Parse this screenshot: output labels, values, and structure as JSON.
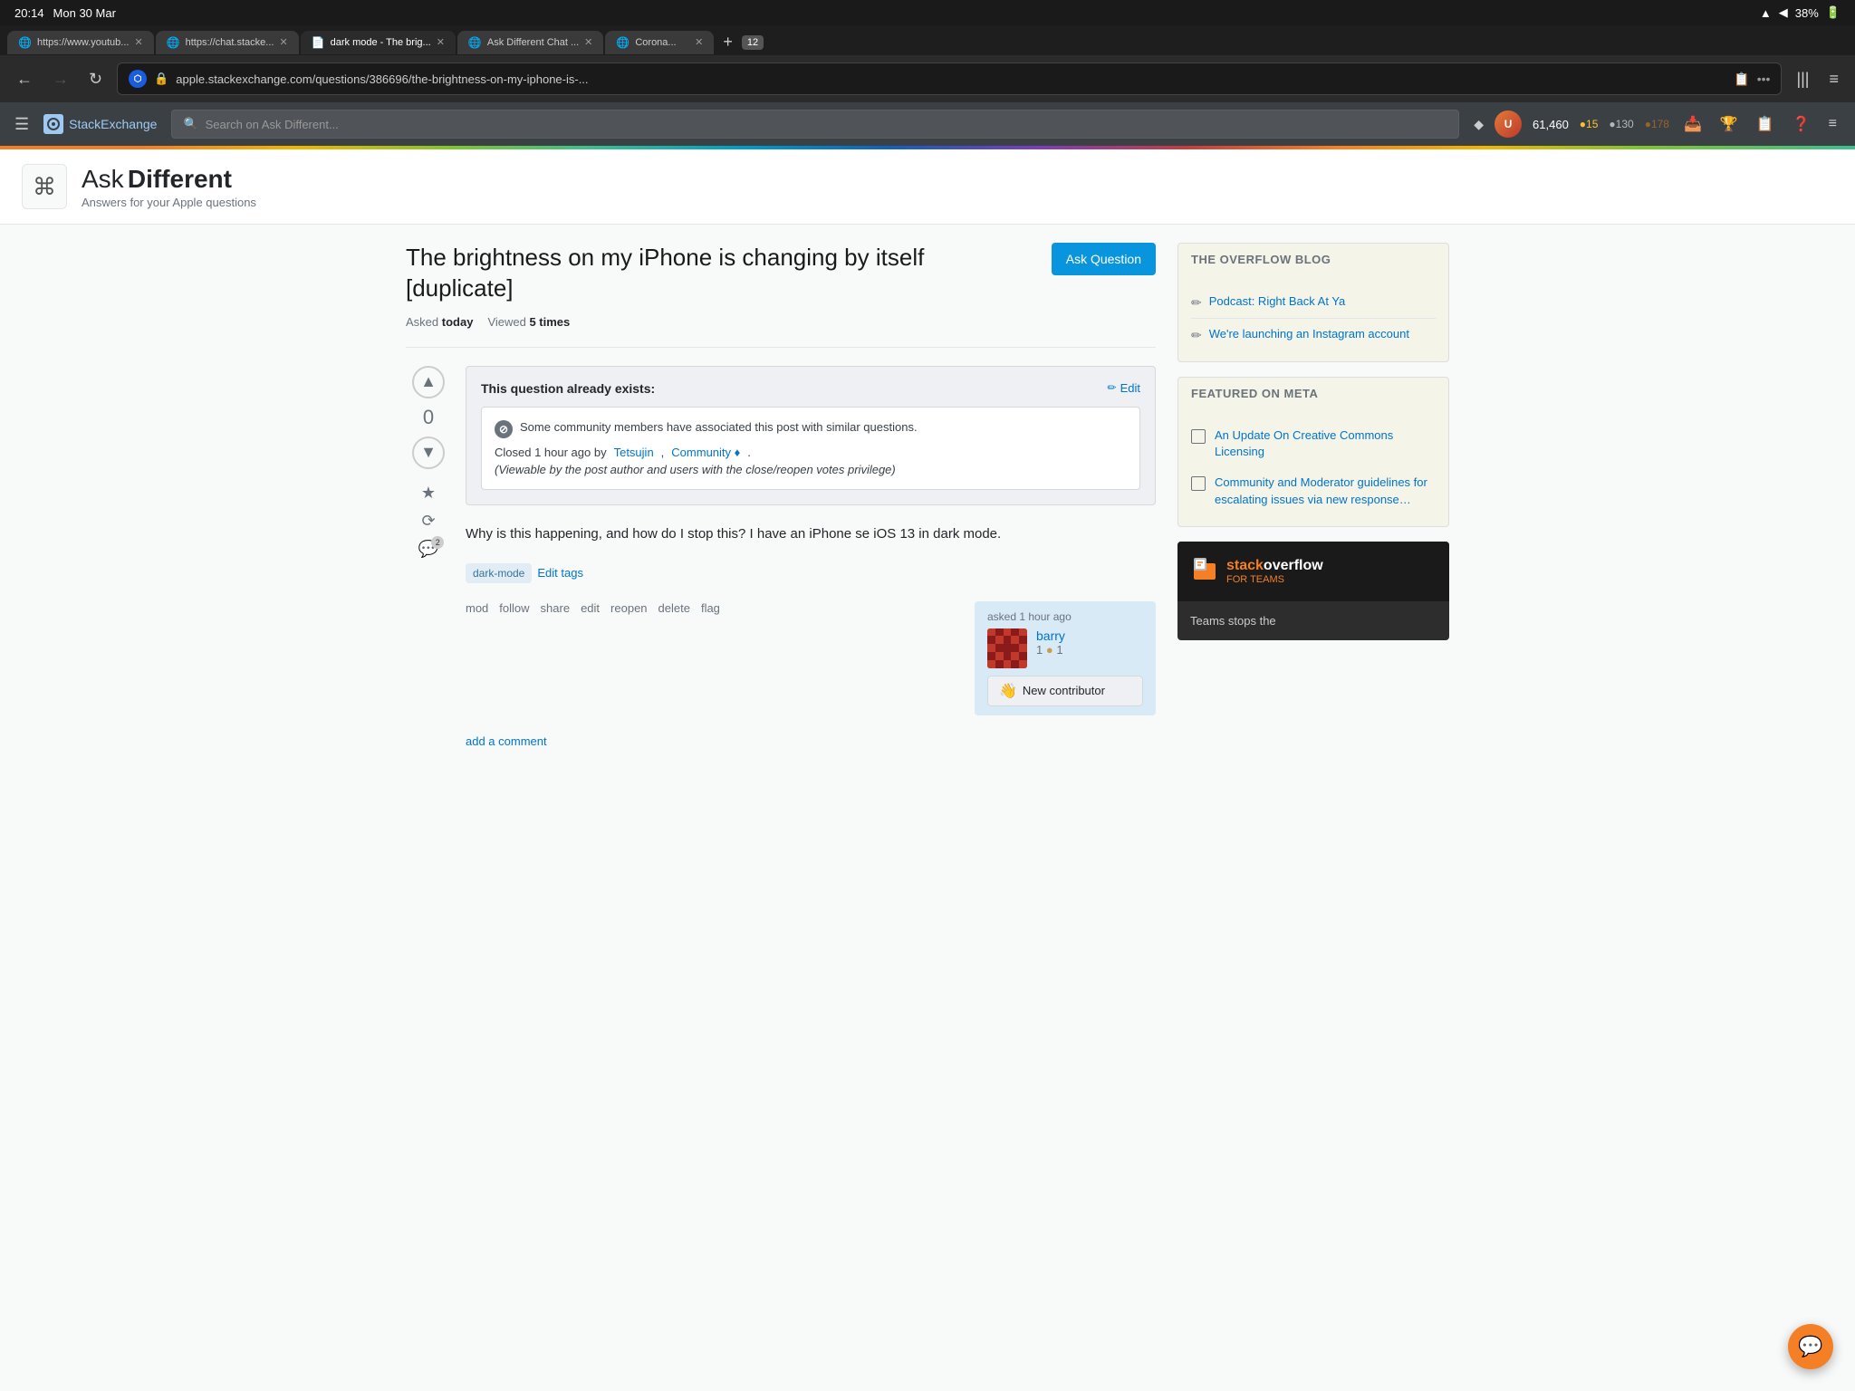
{
  "statusBar": {
    "time": "20:14",
    "date": "Mon 30 Mar",
    "wifi": "WiFi",
    "signal": "Signal",
    "battery": "38%"
  },
  "browser": {
    "tabs": [
      {
        "id": "tab1",
        "icon": "🌐",
        "label": "https://www.youtub...",
        "active": false
      },
      {
        "id": "tab2",
        "icon": "🌐",
        "label": "https://chat.stacke...",
        "active": false
      },
      {
        "id": "tab3",
        "icon": "📄",
        "label": "dark mode - The brig...",
        "active": true
      },
      {
        "id": "tab4",
        "icon": "🌐",
        "label": "Ask Different Chat ...",
        "active": false
      },
      {
        "id": "tab5",
        "icon": "🌐",
        "label": "Corona...",
        "active": false
      }
    ],
    "extraTabCount": "12",
    "addressBar": {
      "url": "apple.stackexchange.com/questions/386696/the-brightness-on-my-iphone-is-..."
    }
  },
  "seHeader": {
    "logoText": "StackExchange",
    "searchPlaceholder": "Search on Ask Different...",
    "reputation": "61,460",
    "repGold": "15",
    "repSilver": "130",
    "repBronze": "178"
  },
  "siteName": {
    "ask": "Ask",
    "different": "Different",
    "tagline": "Answers for your Apple questions"
  },
  "question": {
    "title": "The brightness on my iPhone is changing by itself [duplicate]",
    "askButtonLabel": "Ask Question",
    "askedLabel": "Asked",
    "askedValue": "today",
    "viewedLabel": "Viewed",
    "viewedValue": "5 times",
    "voteCount": "0",
    "duplicateNotice": {
      "title": "This question already exists:",
      "editLabel": "Edit",
      "innerText": "Some community members have associated this post with similar questions.",
      "closedBy": "Closed 1 hour ago by",
      "closedByUsers": [
        "Tetsujin",
        "Community ♦"
      ],
      "viewableNote": "(Viewable by the post author and users with the close/reopen votes privilege)"
    },
    "bodyText": "Why is this happening, and how do I stop this? I have an iPhone se iOS 13 in dark mode.",
    "tags": [
      "dark-mode"
    ],
    "editTagsLabel": "Edit tags",
    "actions": {
      "mod": "mod",
      "follow": "follow",
      "share": "share",
      "edit": "edit",
      "reopen": "reopen",
      "delete": "delete",
      "flag": "flag"
    },
    "askedCard": {
      "label": "asked 1 hour ago",
      "username": "barry",
      "rep": "1",
      "repBullet": "1",
      "newContributorLabel": "New contributor"
    },
    "addCommentLabel": "add a comment",
    "commentCount": "2"
  },
  "sidebar": {
    "overflowBlog": {
      "header": "The Overflow Blog",
      "items": [
        {
          "icon": "✏",
          "text": "Podcast: Right Back At Ya"
        },
        {
          "icon": "✏",
          "text": "We're launching an Instagram account"
        }
      ]
    },
    "featuredMeta": {
      "header": "Featured on Meta",
      "items": [
        {
          "text": "An Update On Creative Commons Licensing"
        },
        {
          "text": "Community and Moderator guidelines for escalating issues via new response…"
        }
      ]
    },
    "soTeams": {
      "title": "stackoverflow",
      "subtitle": "FOR TEAMS",
      "bodyText": "Teams stops the"
    }
  },
  "chatBubble": "💬"
}
